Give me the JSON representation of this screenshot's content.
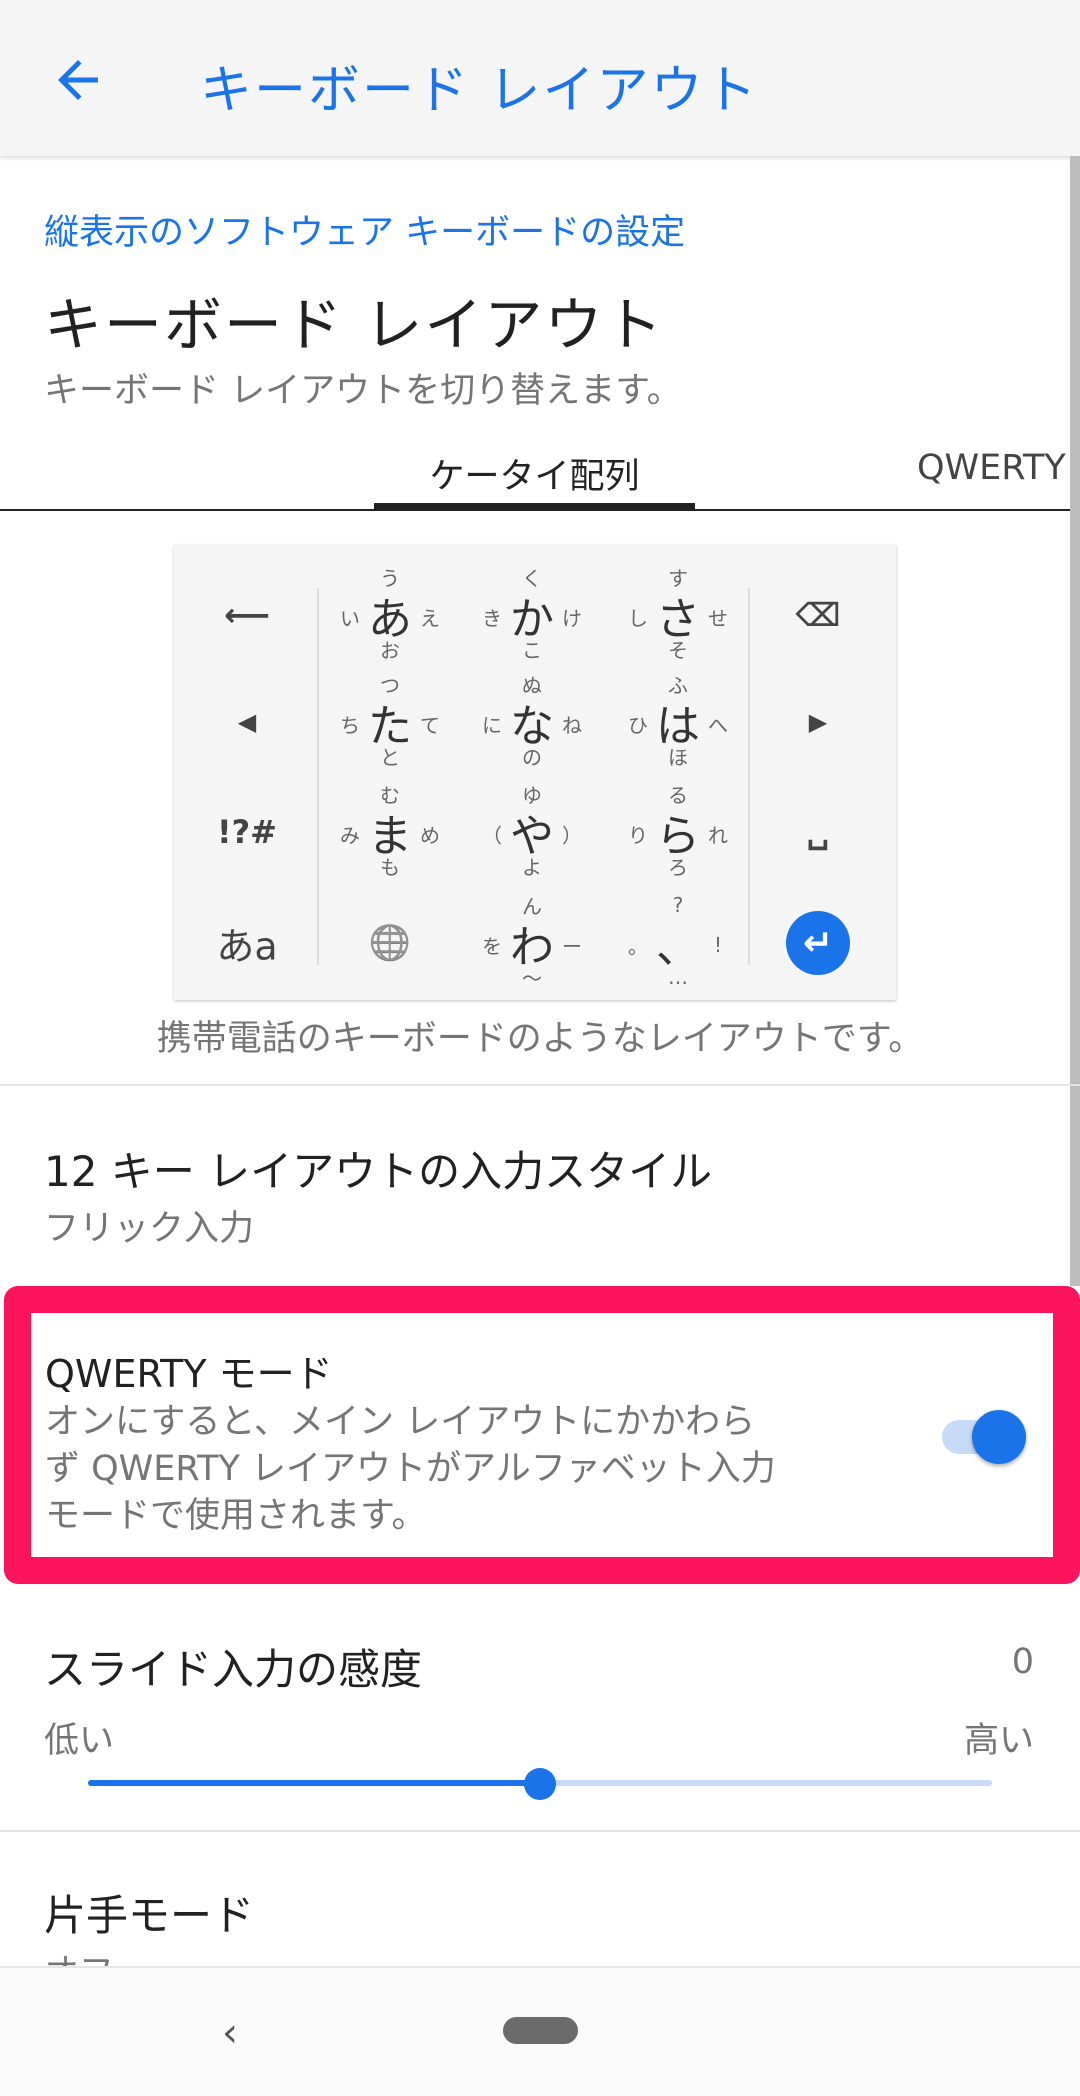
{
  "header": {
    "title": "キーボード レイアウト",
    "back_icon": "arrow-left-icon"
  },
  "breadcrumb": "縦表示のソフトウェア キーボードの設定",
  "section": {
    "title": "キーボード レイアウト",
    "subtitle": "キーボード レイアウトを切り替えます。"
  },
  "tabs": [
    {
      "label": "ケータイ配列",
      "selected": true
    },
    {
      "label": "QWERTY",
      "selected": false
    }
  ],
  "keyboard": {
    "left": [
      "backspace-arrow-icon",
      "cursor-left-icon",
      "!?#",
      "あa"
    ],
    "right": [
      "delete-icon",
      "cursor-right-icon",
      "space-icon",
      "enter-icon"
    ],
    "keys": [
      {
        "c": "あ",
        "u": "う",
        "l": "い",
        "r": "え",
        "d": "お"
      },
      {
        "c": "か",
        "u": "く",
        "l": "き",
        "r": "け",
        "d": "こ"
      },
      {
        "c": "さ",
        "u": "す",
        "l": "し",
        "r": "せ",
        "d": "そ"
      },
      {
        "c": "た",
        "u": "つ",
        "l": "ち",
        "r": "て",
        "d": "と"
      },
      {
        "c": "な",
        "u": "ぬ",
        "l": "に",
        "r": "ね",
        "d": "の"
      },
      {
        "c": "は",
        "u": "ふ",
        "l": "ひ",
        "r": "へ",
        "d": "ほ"
      },
      {
        "c": "ま",
        "u": "む",
        "l": "み",
        "r": "め",
        "d": "も"
      },
      {
        "c": "や",
        "u": "ゆ",
        "l": "（",
        "r": "）",
        "d": "よ"
      },
      {
        "c": "ら",
        "u": "る",
        "l": "り",
        "r": "れ",
        "d": "ろ"
      },
      {
        "c": "🌐",
        "u": "",
        "l": "",
        "r": "",
        "d": ""
      },
      {
        "c": "わ",
        "u": "ん",
        "l": "を",
        "r": "ー",
        "d": "〜"
      },
      {
        "c": "、",
        "u": "?",
        "l": "。",
        "r": "!",
        "d": "…"
      }
    ],
    "accent": "#1a73e8",
    "caption": "携帯電話のキーボードのようなレイアウトです。"
  },
  "settings": {
    "input_style": {
      "title": "12 キー レイアウトの入力スタイル",
      "value": "フリック入力"
    },
    "qwerty_mode": {
      "title": "QWERTY モード",
      "desc": [
        "オンにすると、メイン レイアウトにかかわら",
        "ず QWERTY レイアウトがアルファベット入力",
        "モードで使用されます。"
      ],
      "enabled": true
    },
    "slide_sensitivity": {
      "title": "スライド入力の感度",
      "value": "0",
      "min_label": "低い",
      "max_label": "高い",
      "level": 0.5
    },
    "one_hand": {
      "title": "片手モード",
      "value": "オフ"
    }
  },
  "highlight_color": "#fc135e"
}
